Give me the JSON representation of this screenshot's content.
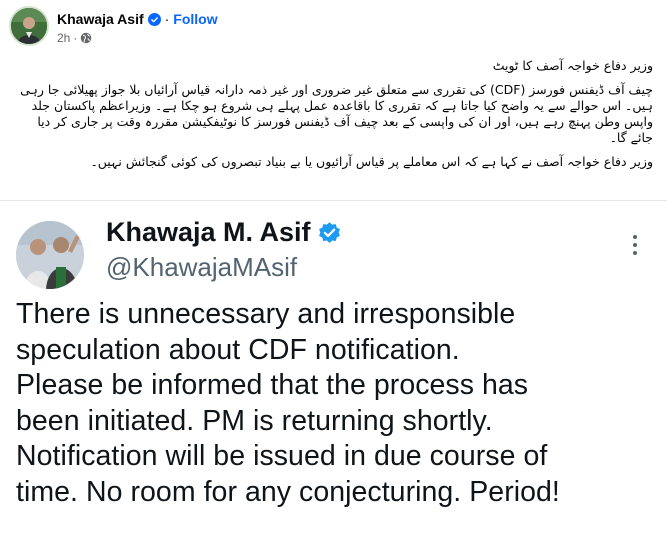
{
  "post": {
    "author": "Khawaja Asif",
    "follow_label": "Follow",
    "separator": "·",
    "timestamp": "2h",
    "icons": {
      "verified": "verified-badge-icon",
      "audience": "globe-icon"
    }
  },
  "caption": {
    "paragraphs": [
      "وزیر دفاع خواجہ آصف کا ٹویٹ",
      "چیف آف ڈیفنس فورسز (CDF) کی تقرری سے متعلق غیر ضروری اور غیر ذمہ دارانہ قیاس آرائیاں بلا جواز پھیلائی جا رہی ہیں۔ اس حوالے سے یہ واضح کیا جاتا ہے کہ تقرری کا باقاعدہ عمل پہلے ہی شروع ہو چکا ہے۔ وزیراعظم پاکستان جلد واپس وطن پہنچ رہے ہیں، اور ان کی واپسی کے بعد چیف آف ڈیفنس فورسز کا نوٹیفکیشن مقررہ وقت پر جاری کر دیا جائے گا۔",
      "وزیر دفاع خواجہ آصف نے کہا ہے کہ اس معاملے پر قیاس آرائیوں یا بے بنیاد تبصروں کی کوئی گنجائش نہیں۔"
    ]
  },
  "tweet": {
    "name": "Khawaja M. Asif",
    "handle": "@KhawajaMAsif",
    "more_icon": "more-options-icon",
    "lines": [
      "There is unnecessary and irresponsible",
      "speculation about CDF notification.",
      "Please be informed that the process has",
      "been initiated. PM is returning shortly.",
      "Notification will be issued in due course of",
      "time. No room for any conjecturing. Period!"
    ]
  },
  "colors": {
    "facebook_blue": "#0866ff",
    "verified_blue": "#1d9bf0",
    "secondary_text": "#65676b",
    "tweet_handle": "#536471"
  }
}
